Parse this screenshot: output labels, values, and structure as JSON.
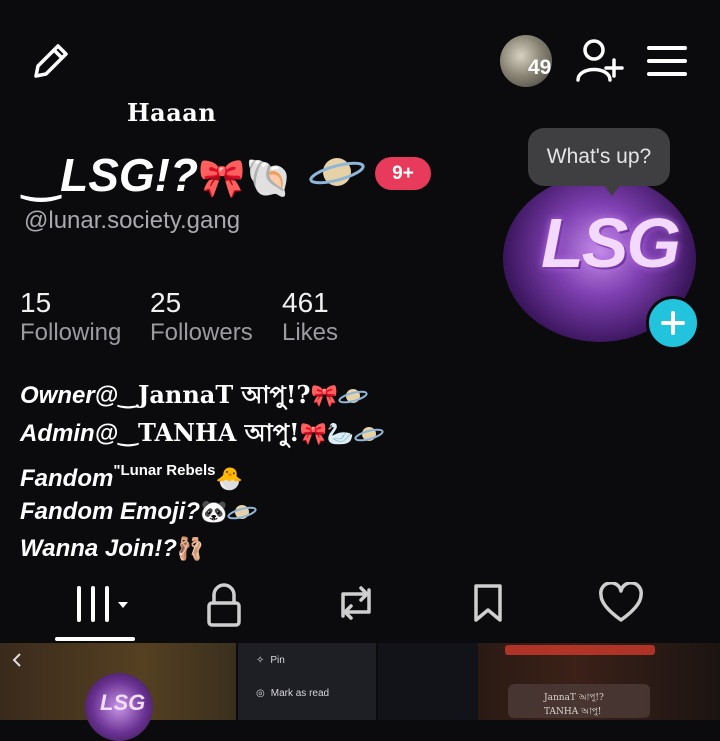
{
  "header": {
    "edit_icon": "pencil-icon",
    "visitor_count": "49",
    "add_friend_icon": "person-add-icon",
    "menu_icon": "hamburger-icon"
  },
  "profile": {
    "nickname": "Haaan",
    "display_name": "‿LSG!?",
    "display_name_emoji": "🎀🐚",
    "notification_badge": "9+",
    "username": "@lunar.society.gang",
    "avatar_text": "LSG",
    "bubble_text": "What's up?"
  },
  "stats": [
    {
      "value": "15",
      "label": "Following"
    },
    {
      "value": "25",
      "label": "Followers"
    },
    {
      "value": "461",
      "label": "Likes"
    }
  ],
  "bio": {
    "line1_prefix": "Owner@‿",
    "line1_name": "JannaT আপু!?",
    "line1_emoji": "🎀",
    "line2_prefix": "Admin@‿",
    "line2_name": "TANHA আপু!",
    "line2_emoji": "🎀🦢",
    "line3_prefix": "Fandom",
    "line3_sup": "\"Lunar Rebels",
    "line3_emoji": "🐣",
    "line4_text": "Fandom Emoji?",
    "line4_emoji": "🐼",
    "line5_text": "Wanna Join!?",
    "line5_emoji": "🩰"
  },
  "tabs": [
    {
      "name": "videos",
      "icon": "grid-icon"
    },
    {
      "name": "private",
      "icon": "lock-icon"
    },
    {
      "name": "reposts",
      "icon": "repost-icon"
    },
    {
      "name": "favorites",
      "icon": "bookmark-icon"
    },
    {
      "name": "liked",
      "icon": "heart-icon"
    }
  ],
  "thumbnails": {
    "thumb1_text": "LSG",
    "menu_pin": "Pin",
    "menu_mark_read": "Mark as read",
    "thumb4_row1": "JannaT আপু!?",
    "thumb4_row2": "TANHA আপু!"
  },
  "colors": {
    "background": "#0b0b0d",
    "badge": "#e83a5a",
    "add_button": "#22c4dd",
    "secondary_text": "#a9a9ae"
  }
}
